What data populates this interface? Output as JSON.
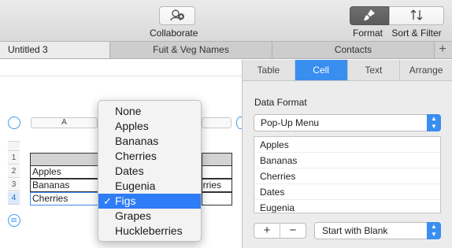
{
  "toolbar": {
    "collaborate_label": "Collaborate",
    "format_label": "Format",
    "sort_filter_label": "Sort & Filter",
    "collaborate_icon": "collaborate-icon",
    "format_icon": "paintbrush-icon",
    "sort_icon": "sort-arrows-icon"
  },
  "sheet_tabs": [
    "Untitled 3",
    "Fuit & Veg Names",
    "Contacts"
  ],
  "add_tab_label": "+",
  "table": {
    "column_header": "A",
    "row_numbers": [
      "1",
      "2",
      "3",
      "4"
    ],
    "col1": [
      "",
      "Apples",
      "Bananas",
      "Cherries"
    ],
    "col2_partial": [
      "",
      "",
      "erries",
      ""
    ]
  },
  "popup_menu": {
    "items": [
      "None",
      "Apples",
      "Bananas",
      "Cherries",
      "Dates",
      "Eugenia",
      "Figs",
      "Grapes",
      "Huckleberries"
    ],
    "selected": "Figs",
    "checkmark": "✓"
  },
  "inspector": {
    "tabs": [
      "Table",
      "Cell",
      "Text",
      "Arrange"
    ],
    "active_tab": "Cell",
    "section_title": "Data Format",
    "format_value": "Pop-Up Menu",
    "list_items": [
      "Apples",
      "Bananas",
      "Cherries",
      "Dates",
      "Eugenia"
    ],
    "add_label": "+",
    "remove_label": "−",
    "start_value": "Start with Blank"
  },
  "colors": {
    "accent": "#3a8ef0",
    "menu_highlight": "#2e7cf6"
  }
}
